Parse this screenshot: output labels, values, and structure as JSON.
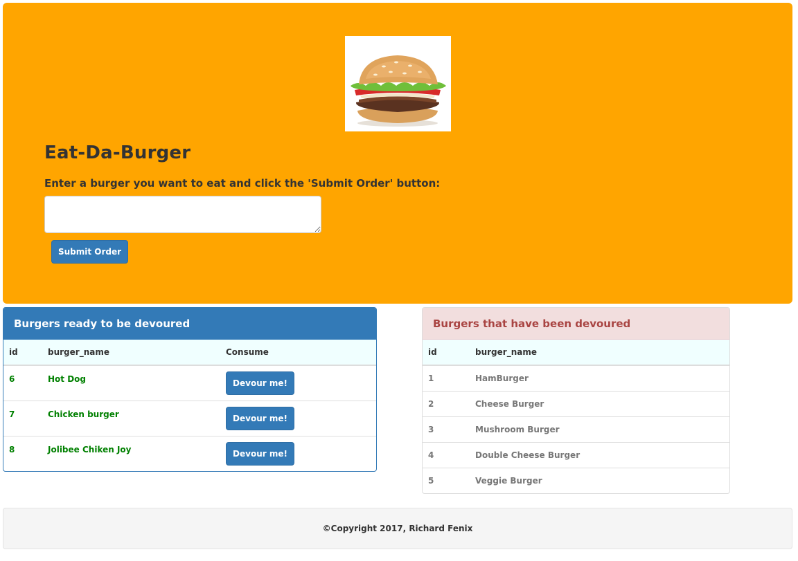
{
  "header": {
    "logo": "burger-icon",
    "title": "Eat-Da-Burger",
    "prompt": "Enter a burger you want to eat and click the 'Submit Order' button:",
    "input_value": "",
    "submit_label": "Submit Order",
    "background_color": "#ffa500"
  },
  "ready_panel": {
    "title": "Burgers ready to be devoured",
    "columns": [
      "id",
      "burger_name",
      "Consume"
    ],
    "button_label": "Devour me!",
    "rows": [
      {
        "id": "6",
        "name": "Hot Dog"
      },
      {
        "id": "7",
        "name": "Chicken burger"
      },
      {
        "id": "8",
        "name": "Jolibee Chiken Joy"
      }
    ],
    "accent_color": "#337ab7",
    "text_color": "#008000"
  },
  "devoured_panel": {
    "title": "Burgers that have been devoured",
    "columns": [
      "id",
      "burger_name"
    ],
    "rows": [
      {
        "id": "1",
        "name": "HamBurger"
      },
      {
        "id": "2",
        "name": "Cheese Burger"
      },
      {
        "id": "3",
        "name": "Mushroom Burger"
      },
      {
        "id": "4",
        "name": "Double Cheese Burger"
      },
      {
        "id": "5",
        "name": "Veggie Burger"
      }
    ],
    "heading_color": "#a94442"
  },
  "footer": {
    "text": "©Copyright 2017, Richard Fenix"
  }
}
